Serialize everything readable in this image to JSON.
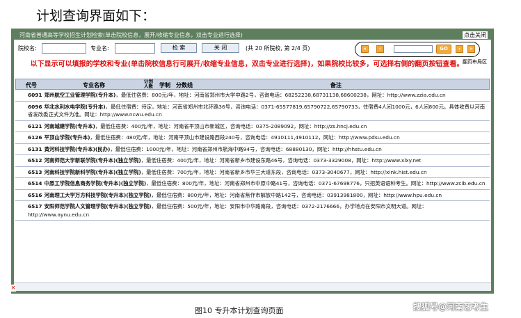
{
  "heading": "计划查询界面如下：",
  "window": {
    "title": "河南省普通高等学校招生计划检索(单击院校信息，展开/收缩专业信息，双击专业进行选择)",
    "close_label": "点击关闭"
  },
  "search": {
    "school_label": "院校名:",
    "major_label": "专业名:",
    "school_value": "",
    "major_value": "",
    "search_button": "检  索",
    "close_button": "关  闭",
    "page_info": "(共 20 所院校, 第 2/4 页)"
  },
  "pager": {
    "first": "«",
    "prev": "‹",
    "next": "›",
    "last": "»",
    "input_value": "",
    "go_label": "GO",
    "caption": "翻页布局区"
  },
  "notice": "以下显示可以填报的学校和专业(单击院校信息行可展开/收缩专业信息，双击专业进行选择)，如果院校比较多，可选择右侧的翻页按钮查看。",
  "table": {
    "headers": {
      "code": "代号",
      "name": "专业名称",
      "plan": "计划人数",
      "system": "学制",
      "line": "分数线",
      "remarks": "备注"
    },
    "rows": [
      {
        "code": "6091",
        "name": "郑州航空工业管理学院(专升本)",
        "detail": "，最低住宿费：800元/年，地址：河南省郑州市大学中路2号，咨询电话：68252238,68731138,68600238，网址：http://www.zzia.edu.cn"
      },
      {
        "code": "6096",
        "name": "华北水利水电学院(专升本)",
        "detail": "，最低住宿费：待定，地址：河南省郑州市北环路36号，咨询电话：0371-65577819,65790722,65790733，住宿费4人间1000元，6人间800元。具体收费以河南省发改委正式文件为准。网址：http://www.ncwu.edu.cn"
      },
      {
        "code": "6121",
        "name": "河南城建学院(专升本)",
        "detail": "，最低住宿费：400元/年，地址：河南省平顶山市新城区，咨询电话：0375-2089092，网址：http://zs.hncj.edu.cn"
      },
      {
        "code": "6126",
        "name": "平顶山学院(专升本)",
        "detail": "，最低住宿费：480元/年，地址：河南平顶山市建设路西段240号，咨询电话：4910111,4910112，网址：http://www.pdsu.edu.cn"
      },
      {
        "code": "6131",
        "name": "黄河科技学院(专升本)(民办)",
        "detail": "，最低住宿费：1000元/年，地址：河南省郑州市航海中路94号，咨询电话：68880130，网址：http://hhstu.edu.cn"
      },
      {
        "code": "6512",
        "name": "河南师范大学新联学院(专升本)(独立学院)",
        "detail": "，最低住宿费：400元/年，地址：河南省新乡市建设东路46号，咨询电话：0373-3329008，网址：http://www.xlxy.net"
      },
      {
        "code": "6513",
        "name": "河南科技学院新科学院(专升本)(独立学院)",
        "detail": "，最低住宿费：700元/年，地址：河南省新乡市华兰大道东段，咨询电话：0373-3040677，网址：http://xink.hist.edu.cn"
      },
      {
        "code": "6514",
        "name": "中原工学院信息商务学院(专升本)(独立学院)",
        "detail": "，最低住宿费：800元/年，地址：河南省郑州市中原中路41号，咨询电话：0371-67698776，只招英语语种考生。网址：http://www.zcib.edu.cn"
      },
      {
        "code": "6516",
        "name": "河南理工大学万方科技学院(专升本)(独立学院)",
        "detail": "，最低住宿费：800元/年，地址：河南省焦作市解放中路142号，咨询电话：03913981800，网址：http://www.hpu.edu.cn"
      },
      {
        "code": "6517",
        "name": "安阳师范学院人文管理学院(专升本)(独立学院)",
        "detail": "，最低住宿费：500元/年，地址：安阳市中华路南段，咨询电话：0372-2176666，办学地点在安阳市文明大道。网址：http://www.aynu.edu.cn"
      }
    ]
  },
  "corner_mark": "×",
  "caption": "图10  专升本计划查询页面",
  "watermark": "搜狐号@河南艺考生",
  "colors": {
    "frame": "#5e7f5e",
    "notice": "#e01010",
    "header_bg": "#c9d3e2",
    "pager_button": "#f2a93b"
  }
}
